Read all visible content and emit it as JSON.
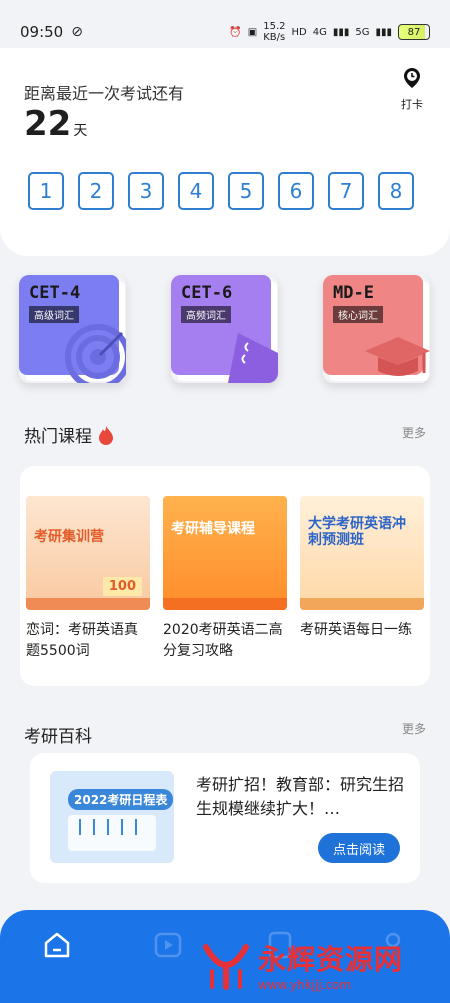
{
  "status_bar": {
    "time": "09:50",
    "net_speed": "15.2",
    "net_unit": "KB/s",
    "network": "4G",
    "network2": "5G",
    "battery": "87"
  },
  "countdown": {
    "label": "距离最近一次考试还有",
    "days": "22",
    "unit": "天",
    "checkin_label": "打卡"
  },
  "exam_numbers": [
    "1",
    "2",
    "3",
    "4",
    "5",
    "6",
    "7",
    "8"
  ],
  "books": [
    {
      "title": "CET-4",
      "tag": "高级词汇",
      "color": "#7b7df0"
    },
    {
      "title": "CET-6",
      "tag": "高频词汇",
      "color": "#a57ef0"
    },
    {
      "title": "MD-E",
      "tag": "核心词汇",
      "color": "#f08585"
    }
  ],
  "hot_courses": {
    "title": "热门课程",
    "more": "更多",
    "items": [
      {
        "title": "恋词：考研英语真题5500词",
        "banner": "考研集训营",
        "badge": "100"
      },
      {
        "title": "2020考研英语二高分复习攻略",
        "banner": "考研辅导课程"
      },
      {
        "title": "考研英语每日一练",
        "banner": "大学考研英语冲刺预测班"
      }
    ]
  },
  "wiki": {
    "title": "考研百科",
    "more": "更多",
    "article_title": "考研扩招！教育部：研究生招生规模继续扩大！…",
    "thumb_text": "2022考研日程表",
    "read_button": "点击阅读"
  },
  "watermark": {
    "name": "永辉资源网",
    "url": "www.yhkjjj.com"
  }
}
